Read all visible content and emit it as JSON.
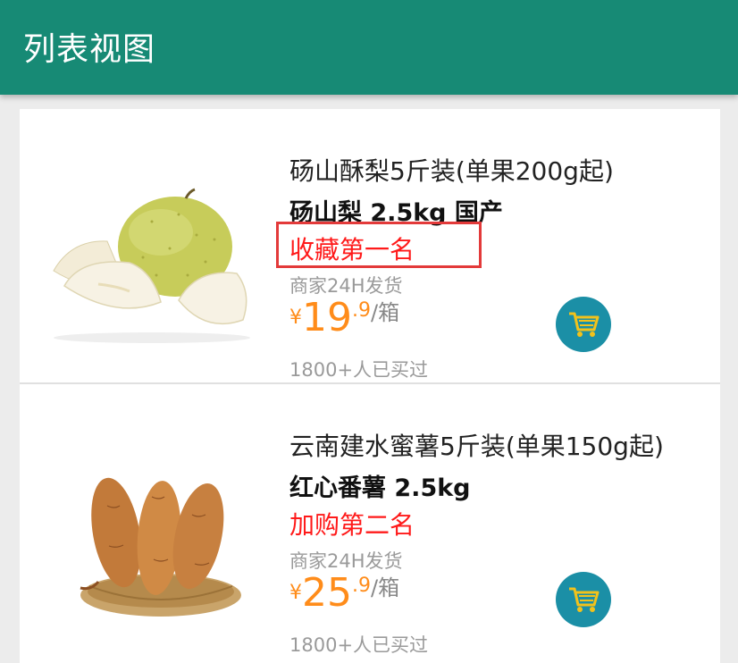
{
  "appbar": {
    "title": "列表视图"
  },
  "products": [
    {
      "name": "砀山酥梨5斤装(单果200g起)",
      "spec": "砀山梨 2.5kg 国产",
      "rank": "收藏第一名",
      "shipping": "商家24H发货",
      "price_symbol": "¥",
      "price_int": "19",
      "price_dec": ".9",
      "price_unit": "/箱",
      "sold": "1800+人已买过",
      "image": "pear-image",
      "cart_icon": "shopping-cart-icon"
    },
    {
      "name": "云南建水蜜薯5斤装(单果150g起)",
      "spec": "红心番薯 2.5kg",
      "rank": "加购第二名",
      "shipping": "商家24H发货",
      "price_symbol": "¥",
      "price_int": "25",
      "price_dec": ".9",
      "price_unit": "/箱",
      "sold": "1800+人已买过",
      "image": "sweet-potato-image",
      "cart_icon": "shopping-cart-icon"
    }
  ],
  "colors": {
    "appbar": "#178a75",
    "price": "#ff8c1a",
    "rank": "#ff1a1a",
    "cart": "#1b8fa6",
    "highlight_box": "#e33a3a"
  }
}
